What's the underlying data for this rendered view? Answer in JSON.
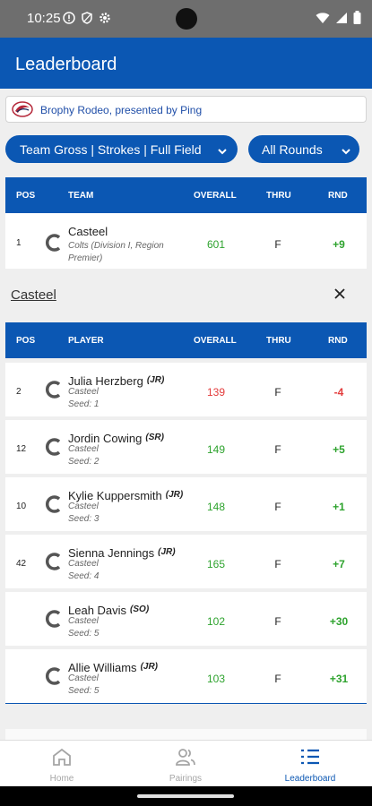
{
  "status": {
    "time": "10:25"
  },
  "app": {
    "title": "Leaderboard"
  },
  "event": {
    "name": "Brophy Rodeo, presented by Ping"
  },
  "filters": {
    "view": "Team Gross | Strokes | Full Field",
    "rounds": "All Rounds"
  },
  "team_table": {
    "headers": {
      "pos": "POS",
      "name": "TEAM",
      "overall": "OVERALL",
      "thru": "THRU",
      "rnd": "RND"
    },
    "rows": [
      {
        "pos": "1",
        "name": "Casteel",
        "line1": "Colts (Division I, Region",
        "line2": "Premier)",
        "overall": "601",
        "thru": "F",
        "rnd": "+9"
      }
    ]
  },
  "section": {
    "title": "Casteel"
  },
  "player_table": {
    "headers": {
      "pos": "POS",
      "name": "PLAYER",
      "overall": "OVERALL",
      "thru": "THRU",
      "rnd": "RND"
    },
    "rows": [
      {
        "pos": "2",
        "name": "Julia Herzberg",
        "year": "(JR)",
        "team": "Casteel",
        "seed": "Seed: 1",
        "overall": "139",
        "thru": "F",
        "rnd": "-4"
      },
      {
        "pos": "12",
        "name": "Jordin Cowing",
        "year": "(SR)",
        "team": "Casteel",
        "seed": "Seed: 2",
        "overall": "149",
        "thru": "F",
        "rnd": "+5"
      },
      {
        "pos": "10",
        "name": "Kylie Kuppersmith",
        "year": "(JR)",
        "team": "Casteel",
        "seed": "Seed: 3",
        "overall": "148",
        "thru": "F",
        "rnd": "+1"
      },
      {
        "pos": "42",
        "name": "Sienna Jennings",
        "year": "(JR)",
        "team": "Casteel",
        "seed": "Seed: 4",
        "overall": "165",
        "thru": "F",
        "rnd": "+7"
      },
      {
        "pos": "",
        "name": "Leah Davis",
        "year": "(SO)",
        "team": "Casteel",
        "seed": "Seed: 5",
        "overall": "102",
        "thru": "F",
        "rnd": "+30"
      },
      {
        "pos": "",
        "name": "Allie Williams",
        "year": "(JR)",
        "team": "Casteel",
        "seed": "Seed: 5",
        "overall": "103",
        "thru": "F",
        "rnd": "+31"
      }
    ]
  },
  "nav": {
    "home": "Home",
    "pairings": "Pairings",
    "leaderboard": "Leaderboard"
  },
  "colors": {
    "primary": "#0b57b3",
    "positive": "#2ea32e",
    "negative": "#e33b3b"
  }
}
